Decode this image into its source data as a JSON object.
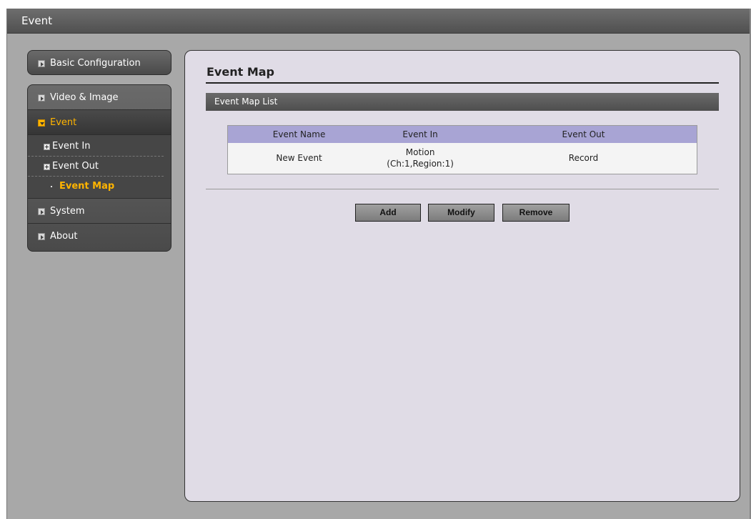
{
  "window": {
    "title": "Event"
  },
  "sidebar": {
    "basic": "Basic Configuration",
    "items": [
      {
        "label": "Video & Image"
      },
      {
        "label": "Event"
      },
      {
        "label": "System"
      },
      {
        "label": "About"
      }
    ],
    "submenu": [
      {
        "label": "Event In"
      },
      {
        "label": "Event Out"
      },
      {
        "label": "Event Map"
      }
    ],
    "active": "Event",
    "current_sub": "Event Map"
  },
  "main": {
    "page_title": "Event Map",
    "section_title": "Event Map List",
    "table": {
      "headers": [
        "Event Name",
        "Event In",
        "Event Out"
      ],
      "rows": [
        {
          "name": "New Event",
          "in_line1": "Motion",
          "in_line2": "(Ch:1,Region:1)",
          "out": "Record"
        }
      ]
    },
    "buttons": {
      "add": "Add",
      "modify": "Modify",
      "remove": "Remove"
    }
  },
  "colors": {
    "accent": "#ffb400",
    "panel_bg": "#e0dce6",
    "table_header": "#a8a4d4"
  }
}
